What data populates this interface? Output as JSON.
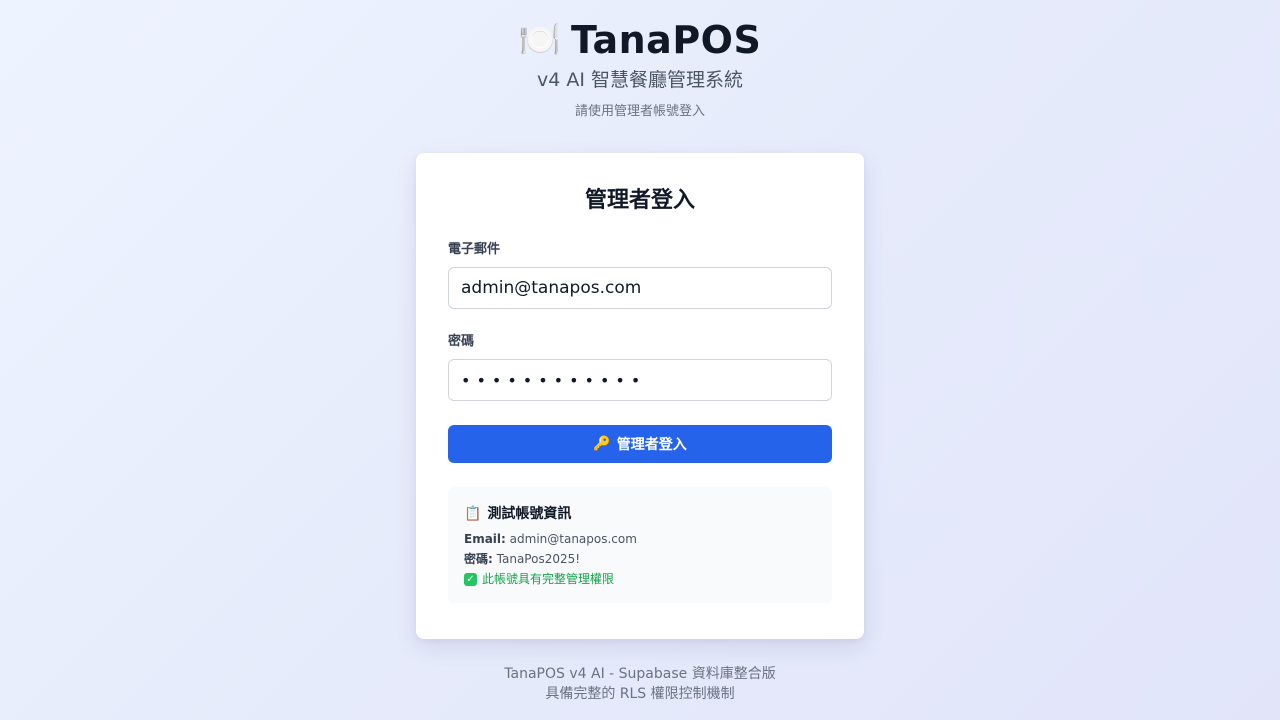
{
  "header": {
    "brand_icon": "🍽️",
    "brand_name": "TanaPOS",
    "subtitle": "v4 AI 智慧餐廳管理系統",
    "hint": "請使用管理者帳號登入"
  },
  "login": {
    "title": "管理者登入",
    "email_label": "電子郵件",
    "email_value": "admin@tanapos.com",
    "password_label": "密碼",
    "password_value": "TanaPos2025!",
    "button_icon": "🔑",
    "button_label": "管理者登入"
  },
  "test_account": {
    "icon": "📋",
    "title": "測試帳號資訊",
    "email_key": "Email:",
    "email_value": "admin@tanapos.com",
    "password_key": "密碼:",
    "password_value": "TanaPos2025!",
    "check_icon": "✓",
    "note": "此帳號具有完整管理權限"
  },
  "footer": {
    "line1": "TanaPOS v4 AI - Supabase 資料庫整合版",
    "line2": "具備完整的 RLS 權限控制機制"
  },
  "colors": {
    "primary": "#2563eb",
    "success": "#16a34a"
  }
}
